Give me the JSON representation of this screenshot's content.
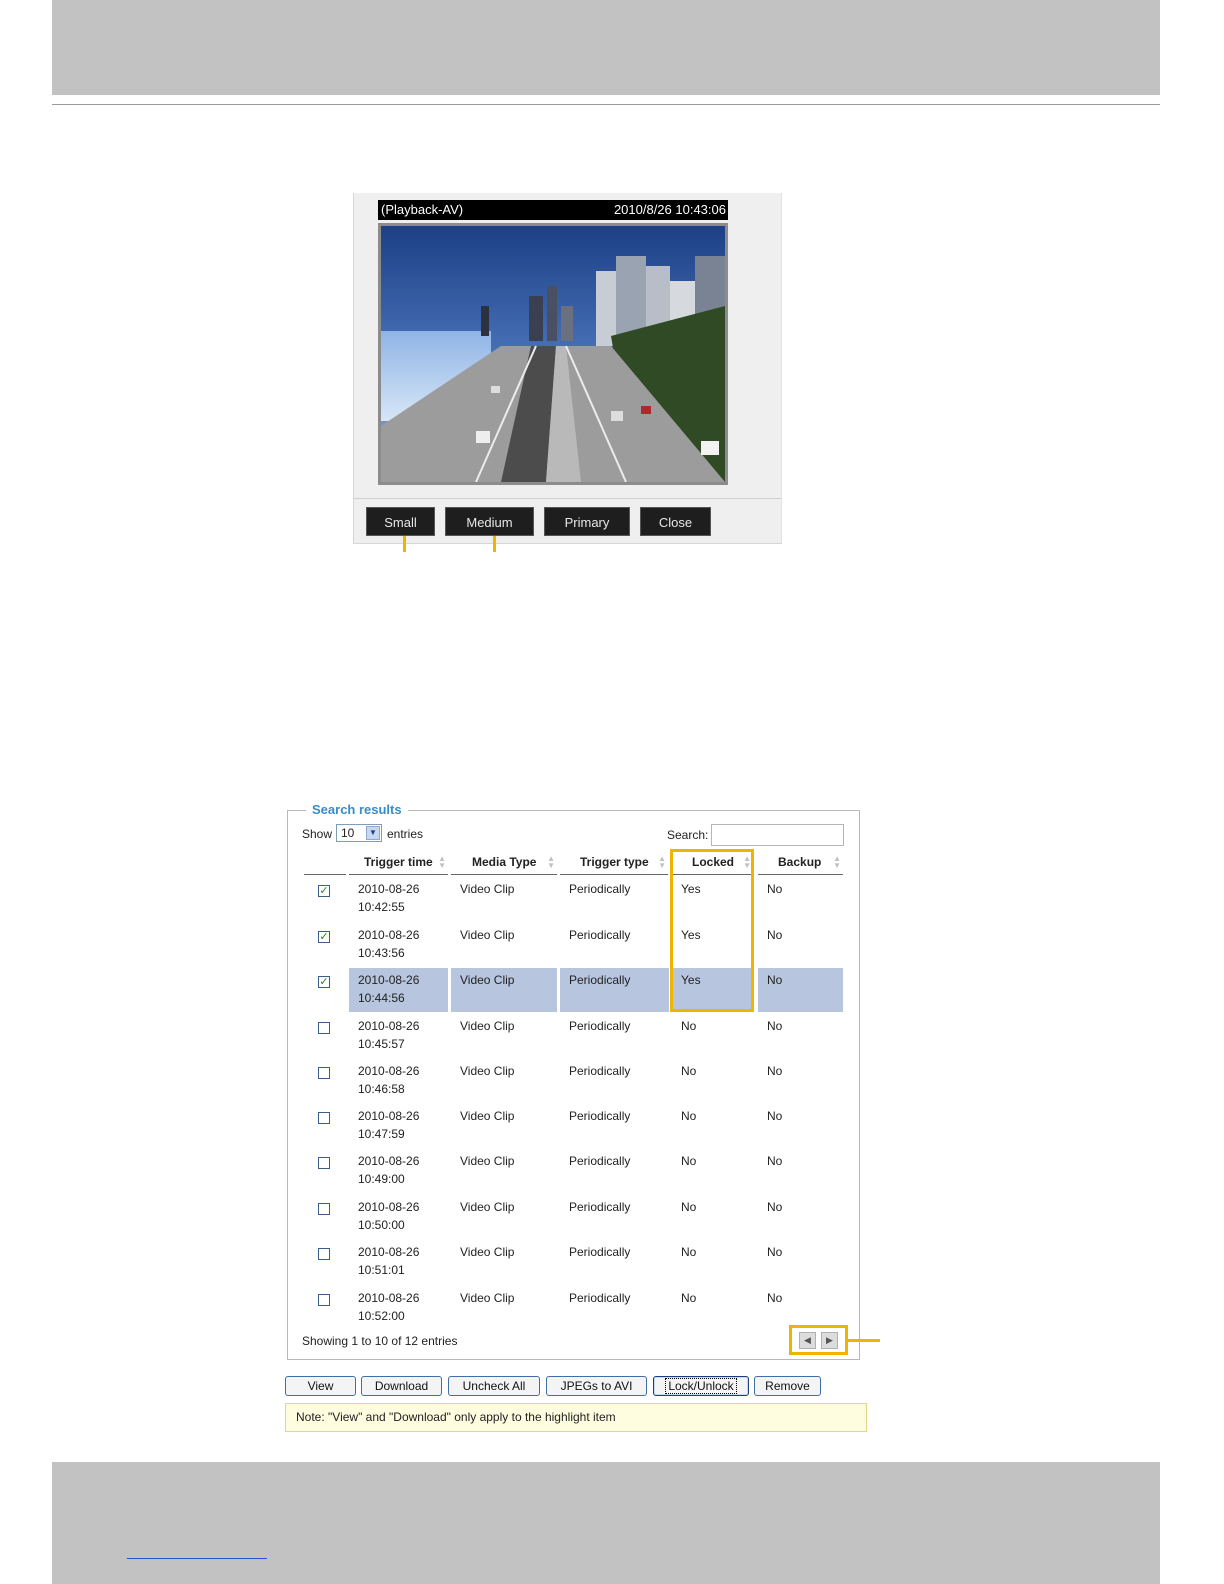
{
  "playback": {
    "title": "(Playback-AV)",
    "timestamp": "2010/8/26 10:43:06",
    "buttons": {
      "small": "Small",
      "medium": "Medium",
      "primary": "Primary",
      "close": "Close"
    }
  },
  "search": {
    "legend": "Search results",
    "show_label": "Show",
    "show_value": "10",
    "entries_label": "entries",
    "search_label": "Search:",
    "search_value": "",
    "columns": [
      "Trigger time",
      "Media Type",
      "Trigger type",
      "Locked",
      "Backup"
    ],
    "rows": [
      {
        "checked": true,
        "date": "2010-08-26",
        "time": "10:42:55",
        "media": "Video Clip",
        "trigger": "Periodically",
        "locked": "Yes",
        "backup": "No"
      },
      {
        "checked": true,
        "date": "2010-08-26",
        "time": "10:43:56",
        "media": "Video Clip",
        "trigger": "Periodically",
        "locked": "Yes",
        "backup": "No"
      },
      {
        "checked": true,
        "date": "2010-08-26",
        "time": "10:44:56",
        "media": "Video Clip",
        "trigger": "Periodically",
        "locked": "Yes",
        "backup": "No",
        "highlighted": true
      },
      {
        "checked": false,
        "date": "2010-08-26",
        "time": "10:45:57",
        "media": "Video Clip",
        "trigger": "Periodically",
        "locked": "No",
        "backup": "No"
      },
      {
        "checked": false,
        "date": "2010-08-26",
        "time": "10:46:58",
        "media": "Video Clip",
        "trigger": "Periodically",
        "locked": "No",
        "backup": "No"
      },
      {
        "checked": false,
        "date": "2010-08-26",
        "time": "10:47:59",
        "media": "Video Clip",
        "trigger": "Periodically",
        "locked": "No",
        "backup": "No"
      },
      {
        "checked": false,
        "date": "2010-08-26",
        "time": "10:49:00",
        "media": "Video Clip",
        "trigger": "Periodically",
        "locked": "No",
        "backup": "No"
      },
      {
        "checked": false,
        "date": "2010-08-26",
        "time": "10:50:00",
        "media": "Video Clip",
        "trigger": "Periodically",
        "locked": "No",
        "backup": "No"
      },
      {
        "checked": false,
        "date": "2010-08-26",
        "time": "10:51:01",
        "media": "Video Clip",
        "trigger": "Periodically",
        "locked": "No",
        "backup": "No"
      },
      {
        "checked": false,
        "date": "2010-08-26",
        "time": "10:52:00",
        "media": "Video Clip",
        "trigger": "Periodically",
        "locked": "No",
        "backup": "No"
      }
    ],
    "showing": "Showing 1 to 10 of 12 entries",
    "actions": {
      "view": "View",
      "download": "Download",
      "uncheck_all": "Uncheck All",
      "jpegs_to_avi": "JPEGs to AVI",
      "lock_unlock": "Lock/Unlock",
      "remove": "Remove"
    },
    "note": "Note: \"View\" and \"Download\" only apply to the highlight item"
  },
  "colors": {
    "accent": "#f0b400",
    "legend": "#3a8cc8",
    "highlight_row": "#b7c5df",
    "band": "#c2c2c2"
  }
}
